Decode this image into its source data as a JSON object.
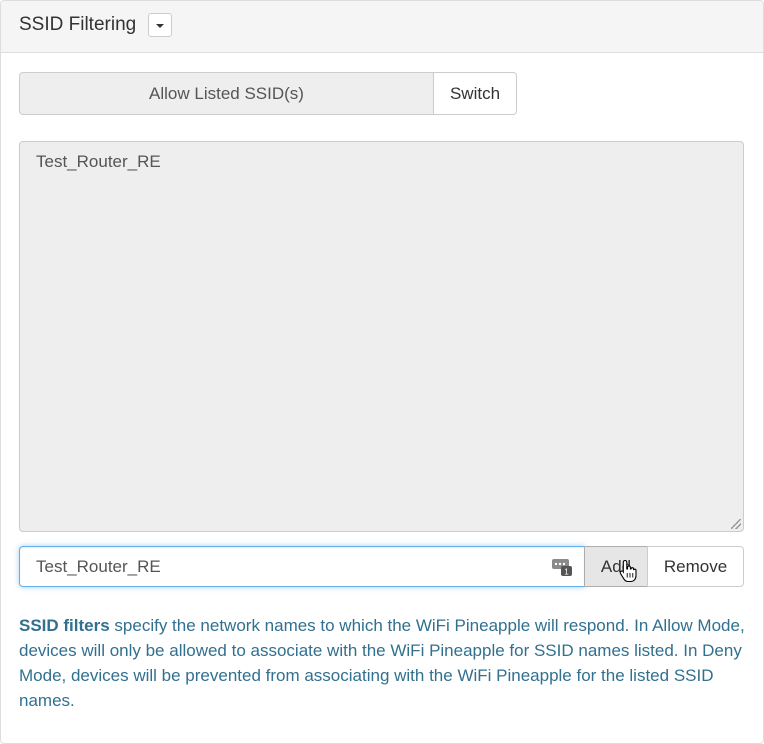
{
  "panel": {
    "title": "SSID Filtering"
  },
  "mode": {
    "label": "Allow Listed SSID(s)",
    "switch_label": "Switch"
  },
  "ssid_list": {
    "content": "Test_Router_RE"
  },
  "ssid_input": {
    "value": "Test_Router_RE",
    "add_label": "Add",
    "remove_label": "Remove"
  },
  "help": {
    "bold": "SSID filters",
    "text": " specify the network names to which the WiFi Pineapple will respond. In Allow Mode, devices will only be allowed to associate with the WiFi Pineapple for SSID names listed. In Deny Mode, devices will be prevented from associating with the WiFi Pineapple for the listed SSID names."
  },
  "icons": {
    "dropdown": "caret-down-icon",
    "password_manager": "password-manager-icon",
    "cursor": "hand-pointer-icon"
  },
  "colors": {
    "heading_bg": "#f5f5f5",
    "readonly_bg": "#eeeeee",
    "focus_border": "#66afe9",
    "help_text": "#31708f"
  }
}
